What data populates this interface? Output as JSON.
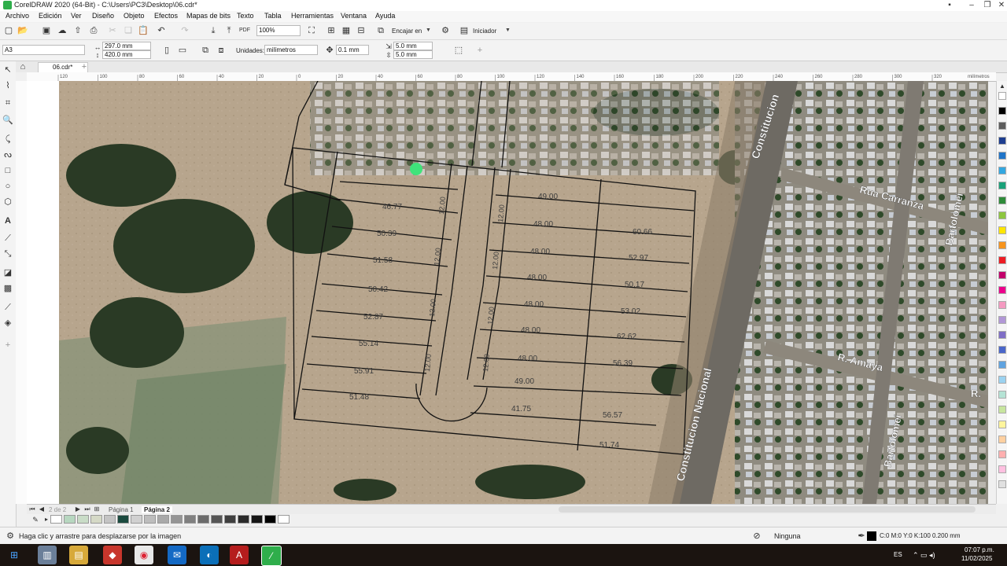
{
  "window": {
    "title": "CorelDRAW 2020 (64-Bit) - C:\\Users\\PC3\\Desktop\\06.cdr*"
  },
  "menu": [
    "Archivo",
    "Edición",
    "Ver",
    "Diseño",
    "Objeto",
    "Efectos",
    "Mapas de bits",
    "Texto",
    "Tabla",
    "Herramientas",
    "Ventana",
    "Ayuda"
  ],
  "toolbar1": {
    "zoom": "100%",
    "snap_label": "Encajar en",
    "launch_label": "Iniciador"
  },
  "toolbar2": {
    "page_size": "A3",
    "width": "297.0 mm",
    "height": "420.0 mm",
    "units_label": "Unidades:",
    "units_value": "milímetros",
    "nudge": "0.1 mm",
    "dup_x": "5.0 mm",
    "dup_y": "5.0 mm"
  },
  "doc_tab": {
    "name": "06.cdr*"
  },
  "ruler": {
    "unit": "milímetros",
    "ticks": [
      "120",
      "100",
      "80",
      "60",
      "40",
      "20",
      "0",
      "20",
      "40",
      "60",
      "80",
      "100",
      "120",
      "140",
      "160",
      "180",
      "200",
      "220",
      "240",
      "260",
      "280",
      "300",
      "320"
    ]
  },
  "page_tabs": {
    "counter": "2 de 2",
    "tabs": [
      "Página 1",
      "Página 2"
    ]
  },
  "status": {
    "hint": "Haga clic y arrastre para desplazarse por la imagen",
    "fill": "Ninguna",
    "outline": "C:0 M:0 Y:0 K:100  0.200 mm"
  },
  "taskbar": {
    "lang": "ES",
    "time": "07:07 p.m.",
    "date": "11/02/2025"
  },
  "map": {
    "streets": [
      "Constitucion",
      "Rua Carranza",
      "Bartolomei",
      "Constitucion Nacional",
      "R. Amaya",
      "Bartolomei",
      "R."
    ],
    "lot_areas_left": [
      "46.77",
      "50.39",
      "51.58",
      "50.42",
      "52.87",
      "55.14",
      "55.91",
      "51.48"
    ],
    "lot_areas_center": [
      "49.00",
      "48.00",
      "48.00",
      "48.00",
      "48.00",
      "48.00",
      "48.00",
      "49.00",
      "41.75"
    ],
    "lot_areas_right": [
      "60.66",
      "52.97",
      "50.17",
      "53.02",
      "62.62",
      "56.39",
      "56.57",
      "51.74"
    ],
    "road_labels": [
      "12.00",
      "12.00",
      "12.00",
      "12.00",
      "12.00",
      "12.00",
      "12.00",
      "12.00"
    ]
  },
  "colors": {
    "accent": "#2fae4b",
    "marker": "#3fe37a",
    "palette": [
      "#ffffff",
      "#000000",
      "#5c5c5c",
      "#1d3d8f",
      "#1f74c8",
      "#33a7e0",
      "#1aa179",
      "#2e8b3a",
      "#8dc63f",
      "#ffe600",
      "#f7941d",
      "#ed1c24",
      "#c2006b",
      "#ec008c",
      "#f49ac1",
      "#b197d6",
      "#7f6ec6",
      "#4a66c9",
      "#5fa3e0",
      "#9bd2f0",
      "#b5e3d5",
      "#c7e59e",
      "#fff59d",
      "#ffd0a0",
      "#ffb0b0",
      "#ffc0e0",
      "#e0e0e0"
    ]
  }
}
